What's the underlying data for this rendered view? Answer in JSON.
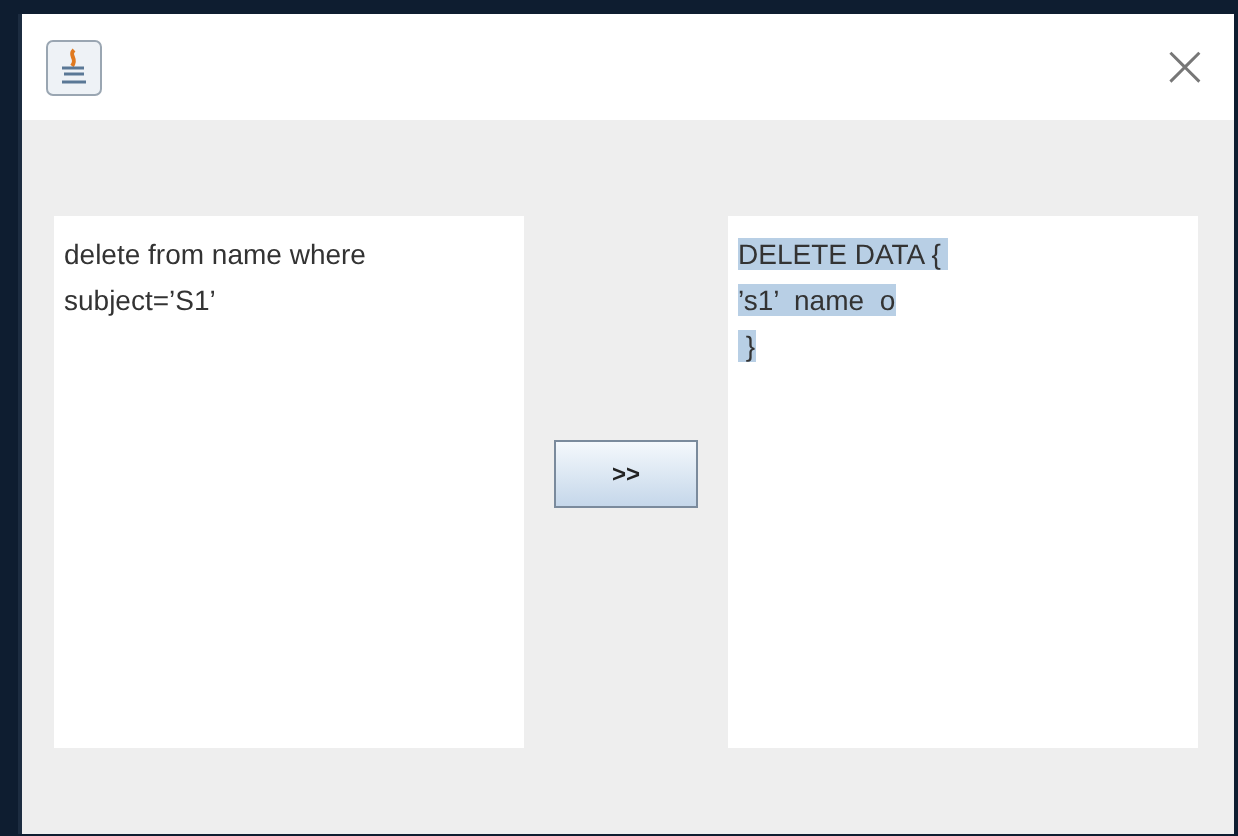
{
  "window": {
    "close_label": "×"
  },
  "source_text": {
    "lines": [
      "delete from name where",
      "subject=’S1’"
    ],
    "selected": false
  },
  "convert_button": {
    "label": ">>"
  },
  "result_text": {
    "lines": [
      "DELETE DATA { ",
      "’s1’  name  o",
      " }"
    ],
    "selected": true
  }
}
